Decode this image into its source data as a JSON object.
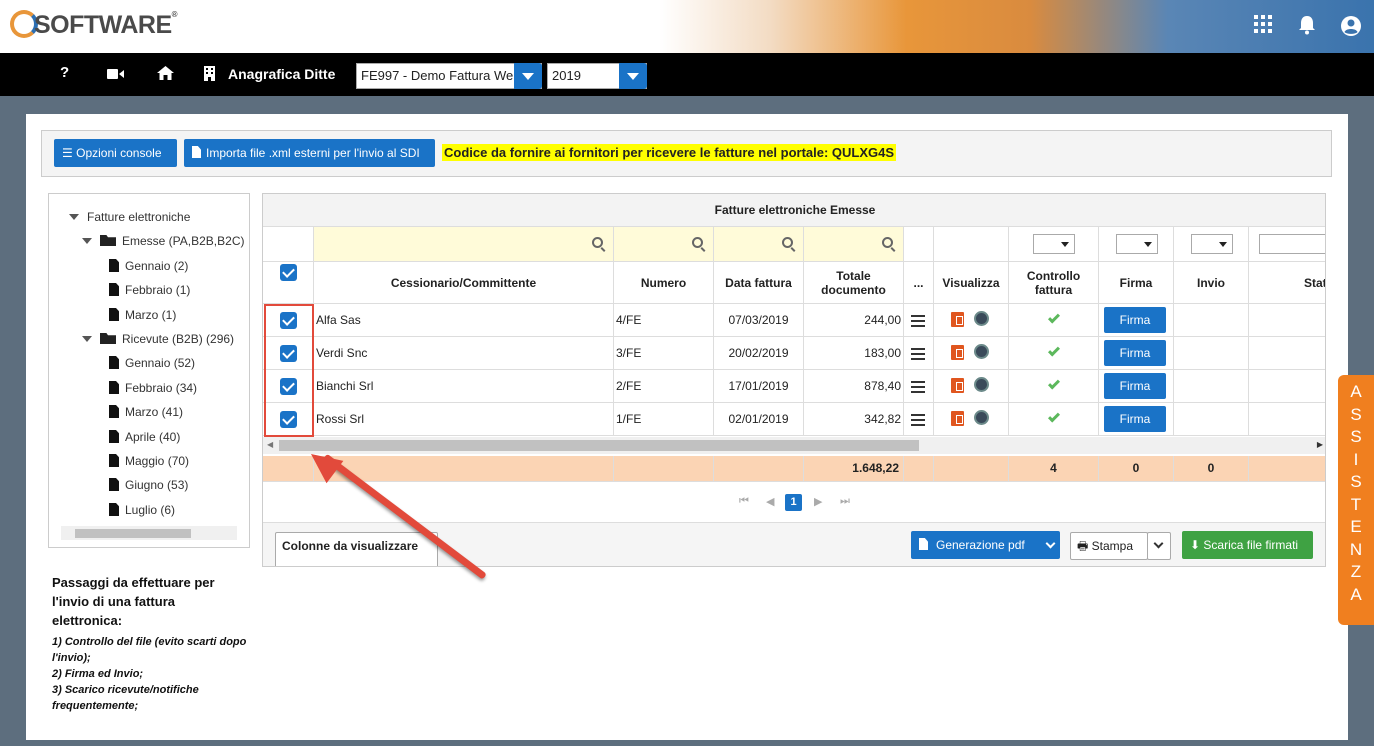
{
  "header": {
    "logo_text": "SOFTWARE",
    "logo_mark": "®",
    "icons": [
      "apps-grid-icon",
      "bell-icon",
      "user-icon"
    ]
  },
  "navbar": {
    "title": "Anagrafica Ditte",
    "company_value": "FE997 - Demo Fattura We",
    "year_value": "2019"
  },
  "toolbar": {
    "options_label": "Opzioni console",
    "import_label": "Importa file .xml esterni per l'invio al SDI",
    "codice_text": "Codice da fornire ai fornitori per ricevere le fatture nel portale: QULXG4S"
  },
  "tree": {
    "root": "Fatture elettroniche",
    "emesse": {
      "label": "Emesse (PA,B2B,B2C)",
      "months": [
        "Gennaio (2)",
        "Febbraio (1)",
        "Marzo (1)"
      ]
    },
    "ricevute": {
      "label": "Ricevute (B2B) (296)",
      "months": [
        "Gennaio (52)",
        "Febbraio (34)",
        "Marzo (41)",
        "Aprile (40)",
        "Maggio (70)",
        "Giugno (53)",
        "Luglio (6)"
      ]
    }
  },
  "steps": {
    "heading": "Passaggi da effettuare per l'invio di una fattura elettronica:",
    "items": [
      "1) Controllo del file (evito scarti dopo l'invio);",
      "2) Firma ed Invio;",
      "3) Scarico ricevute/notifiche frequentemente;"
    ]
  },
  "grid": {
    "title": "Fatture elettroniche Emesse",
    "columns": {
      "cessionario": "Cessionario/Committente",
      "numero": "Numero",
      "data": "Data fattura",
      "totale": "Totale documento",
      "more": "...",
      "visualizza": "Visualizza",
      "controllo": "Controllo fattura",
      "firma": "Firma",
      "invio": "Invio",
      "stato": "Stato"
    },
    "rows": [
      {
        "cessionario": "Alfa Sas",
        "numero": "4/FE",
        "data": "07/03/2019",
        "totale": "244,00",
        "firma": "Firma"
      },
      {
        "cessionario": "Verdi Snc",
        "numero": "3/FE",
        "data": "20/02/2019",
        "totale": "183,00",
        "firma": "Firma"
      },
      {
        "cessionario": "Bianchi Srl",
        "numero": "2/FE",
        "data": "17/01/2019",
        "totale": "878,40",
        "firma": "Firma"
      },
      {
        "cessionario": "Rossi Srl",
        "numero": "1/FE",
        "data": "02/01/2019",
        "totale": "342,82",
        "firma": "Firma"
      }
    ],
    "totals": {
      "totale": "1.648,22",
      "controllo": "4",
      "firma": "0",
      "invio": "0"
    },
    "pager": {
      "current": "1"
    }
  },
  "footer": {
    "columns_label": "Colonne da visualizzare",
    "pdf_label": "Generazione pdf",
    "print_label": "Stampa",
    "download_label": "Scarica file firmati"
  },
  "assist": {
    "letters": [
      "A",
      "S",
      "S",
      "I",
      "S",
      "T",
      "E",
      "N",
      "Z",
      "A"
    ]
  },
  "colors": {
    "primary": "#1a73c7",
    "success": "#3fa243",
    "orange": "#f07f1f",
    "highlight": "#ffff00",
    "annotation": "#e24a3b"
  }
}
